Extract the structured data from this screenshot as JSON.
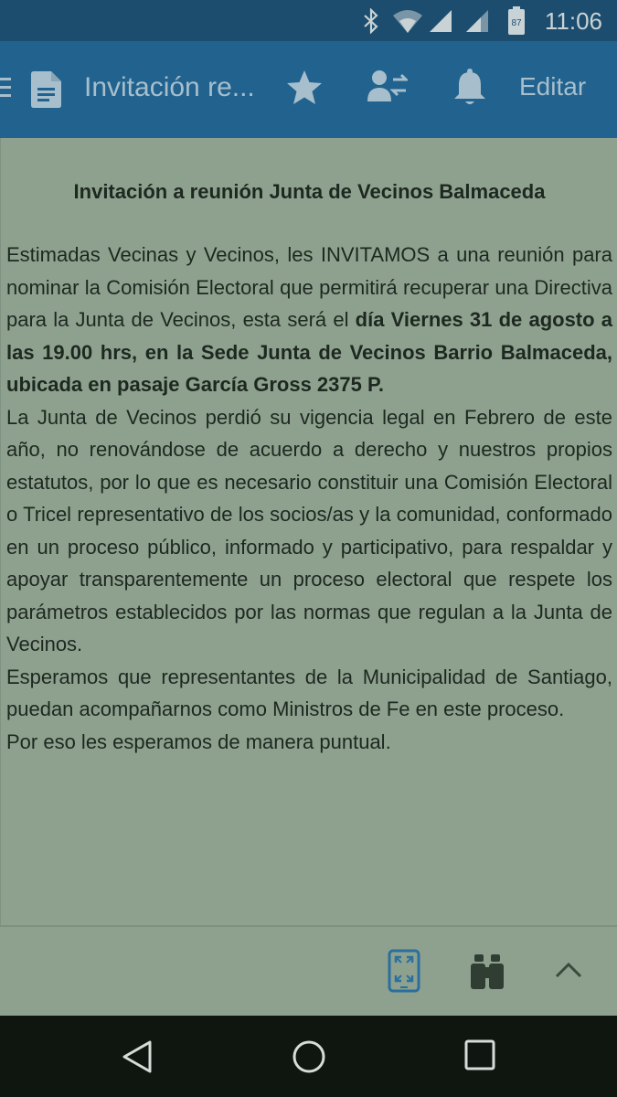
{
  "status_bar": {
    "time": "11:06",
    "battery_level": "87",
    "icons": [
      "bluetooth-icon",
      "wifi-icon",
      "signal-icon",
      "signal-icon",
      "battery-icon"
    ]
  },
  "app_bar": {
    "title": "Invitación re...",
    "edit_label": "Editar",
    "icons": [
      "menu-icon",
      "document-icon",
      "star-icon",
      "share-users-icon",
      "bell-icon"
    ]
  },
  "document": {
    "title": "Invitación a reunión Junta de Vecinos Balmaceda",
    "p1_intro": "Estimadas Vecinas y Vecinos, les INVITAMOS a una reunión para nominar la Comisión Electoral que permitirá recuperar una Directiva para la Junta de Vecinos, esta será el ",
    "p1_bold": "día Viernes 31 de agosto a las 19.00 hrs, en la Sede Junta de Vecinos Barrio Balmaceda, ubicada en pasaje García Gross 2375 P.",
    "p2": "La Junta de Vecinos perdió su vigencia legal en Febrero de este año, no renovándose de acuerdo a derecho y nuestros propios estatutos, por lo que es necesario constituir una Comisión Electoral o Tricel representativo de los socios/as y la comunidad, conformado en un proceso público, informado y participativo, para respaldar y apoyar transparentemente un proceso electoral que respete los parámetros establecidos por las normas que regulan a la Junta de Vecinos.",
    "p3": "Esperamos que representantes de la Municipalidad de Santiago, puedan acompañarnos como Ministros de Fe en este proceso.",
    "p4": "Por eso les esperamos de manera puntual."
  },
  "bottom_toolbar": {
    "icons": [
      "fit-page-icon",
      "binoculars-icon",
      "chevron-up-icon"
    ],
    "accent_color": "#2a6f9e"
  },
  "nav_bar": {
    "icons": [
      "back-icon",
      "home-icon",
      "recents-icon"
    ]
  }
}
